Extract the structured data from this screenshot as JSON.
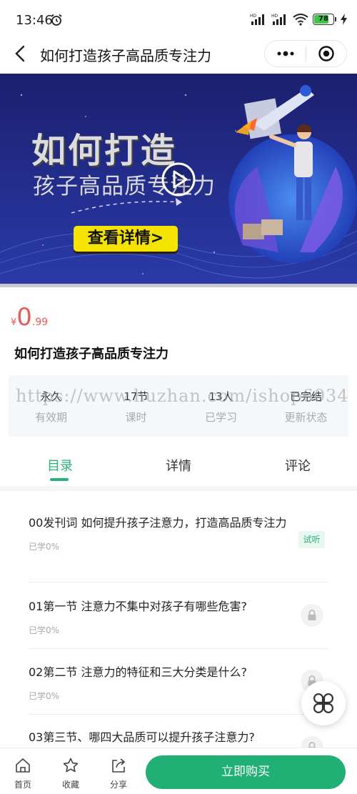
{
  "status_bar": {
    "time": "13:46",
    "battery": "78",
    "battery_level": 0.78,
    "icons": [
      "alarm-icon",
      "hd-signal-icon",
      "hd-signal-icon",
      "wifi-icon",
      "battery-icon",
      "charging-icon"
    ]
  },
  "nav": {
    "title": "如何打造孩子高品质专注力",
    "back_icon": "chevron-left-icon",
    "more_icon": "more-dots-icon",
    "close_icon": "target-close-icon"
  },
  "banner": {
    "title_line1": "如何打造",
    "title_line2": "孩子高品质专注力",
    "cta": "查看详情>",
    "play_icon": "play-icon",
    "colors": {
      "background": "#1b2a86",
      "accent": "#f4e200"
    }
  },
  "course": {
    "price_symbol": "¥",
    "price_integer": "0",
    "price_decimal": ".99",
    "title": "如何打造孩子高品质专注力"
  },
  "stats": [
    {
      "value": "永久",
      "label": "有效期"
    },
    {
      "value": "17节",
      "label": "课时"
    },
    {
      "value": "13人",
      "label": "已学习"
    },
    {
      "value": "已完结",
      "label": "更新状态"
    }
  ],
  "watermark": "https://www.huzhan.com/ishop6034",
  "tabs": [
    {
      "label": "目录",
      "active": true
    },
    {
      "label": "详情",
      "active": false
    },
    {
      "label": "评论",
      "active": false
    }
  ],
  "lessons": [
    {
      "title": "00发刊词 如何提升孩子注意力，打造高品质专注力",
      "progress": "已学0%",
      "badge": "试听"
    },
    {
      "title": "01第一节 注意力不集中对孩子有哪些危害?",
      "progress": "已学0%",
      "badge": ""
    },
    {
      "title": "02第二节 注意力的特征和三大分类是什么?",
      "progress": "已学0%",
      "badge": ""
    },
    {
      "title": "03第三节、哪四大品质可以提升孩子注意力?",
      "progress": "",
      "badge": ""
    }
  ],
  "bottom_bar": {
    "home": "首页",
    "favorite": "收藏",
    "share": "分享",
    "buy": "立即购买"
  },
  "colors": {
    "accent": "#20b076",
    "price": "#e65a5a"
  }
}
